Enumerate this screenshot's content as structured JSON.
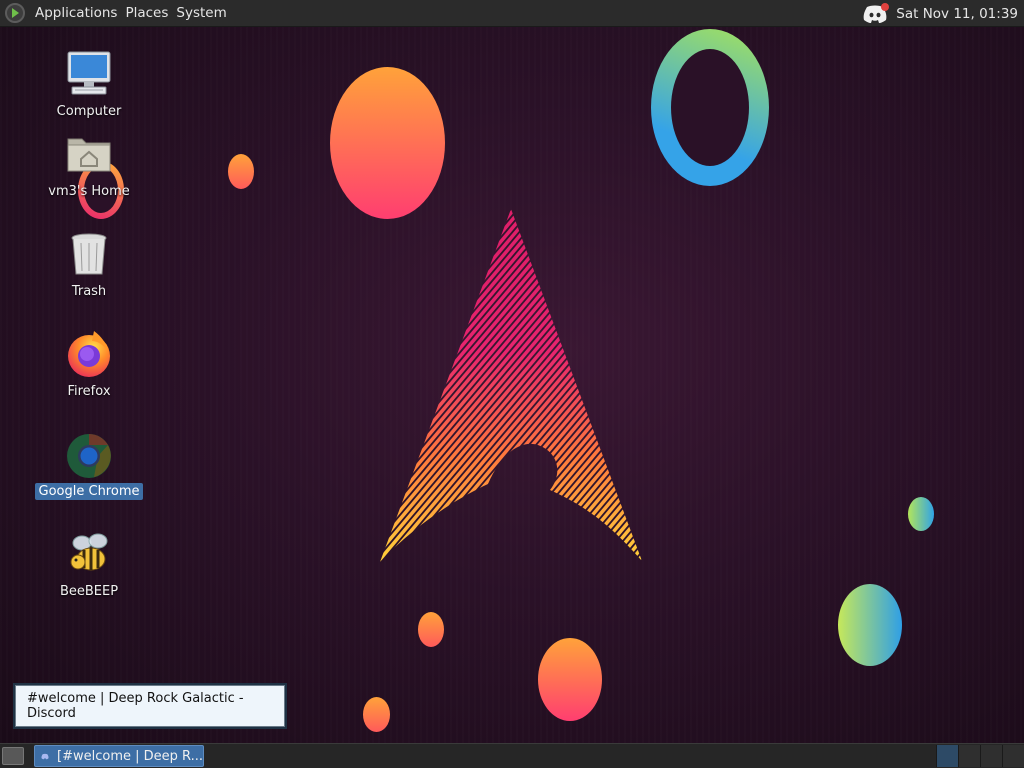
{
  "top_panel": {
    "menus": [
      "Applications",
      "Places",
      "System"
    ],
    "clock": "Sat Nov 11, 01:39"
  },
  "desktop_icons": [
    {
      "label": "Computer"
    },
    {
      "label": "vm3's Home"
    },
    {
      "label": "Trash"
    },
    {
      "label": "Firefox"
    },
    {
      "label": "Google Chrome",
      "selected": true
    },
    {
      "label": "BeeBEEP"
    }
  ],
  "tooltip": "#welcome | Deep Rock Galactic - Discord",
  "taskbar": {
    "window_button": "[#welcome | Deep R..."
  },
  "colors": {
    "panel": "#2b2b2b",
    "selection": "#3d6ea5",
    "wallpaper_bg": "#2a1127",
    "accent_pink": "#e8246e",
    "accent_orange": "#ff9a3c"
  },
  "icons": [
    "menu-logo-icon",
    "discord-icon",
    "computer-icon",
    "home-folder-icon",
    "trash-icon",
    "firefox-icon",
    "chrome-icon",
    "beebeep-icon",
    "show-desktop-icon"
  ]
}
